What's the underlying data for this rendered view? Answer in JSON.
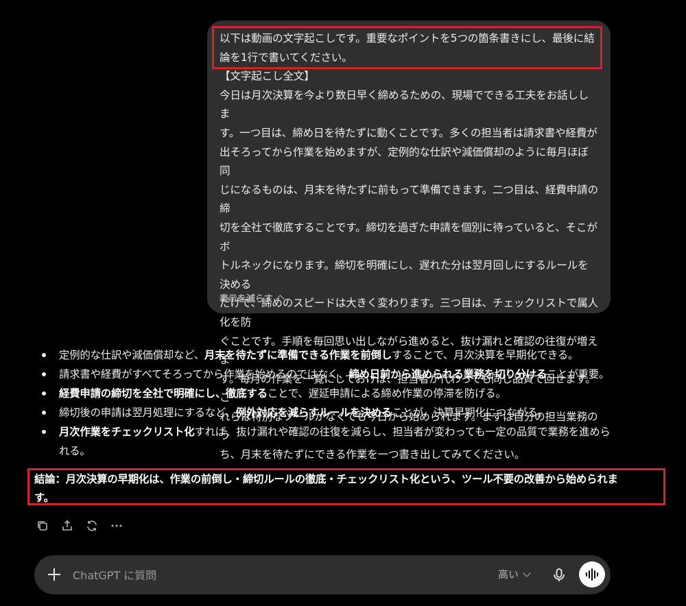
{
  "user_message": {
    "lines": [
      "以下は動画の文字起こしです。重要なポイントを5つの箇条書きにし、最後に結",
      "論を1行で書いてください。",
      "【文字起こし全文】",
      "今日は月次決算を今より数日早く締めるための、現場でできる工夫をお話ししま",
      "す。一つ目は、締め日を待たずに動くことです。多くの担当者は請求書や経費が",
      "出そろってから作業を始めますが、定例的な仕訳や減価償却のように毎月ほぼ同",
      "じになるものは、月末を待たずに前もって準備できます。二つ目は、経費申請の締",
      "切を全社で徹底することです。締切を過ぎた申請を個別に待っていると、そこがボ",
      "トルネックになります。締切を明確にし、遅れた分は翌月回しにするルールを決める",
      "だけで、締めのスピードは大きく変わります。三つ目は、チェックリストで属人化を防",
      "ぐことです。手順を毎回思い出しながら進めると、抜け漏れと確認の往復が増えま",
      "す。毎月の作業を一覧にしておけば、担当者が代わっても同じ品質で回せます。こ",
      "れらは特別なツールがなくても今日から始められます。まずは自分の担当業務のう",
      "ち、月末を待たずにできる作業を一つ書き出してみてください。"
    ],
    "show_less_label": "表示を減らす"
  },
  "response": {
    "bullets": [
      {
        "a": "定例的な仕訳や減価償却など、",
        "b": "月末を待たずに準備できる作業を前倒し",
        "c": "することで、月次決算を早期化できる。"
      },
      {
        "a": "請求書や経費がすべてそろってから作業を始めるのではなく、",
        "b": "締め日前から進められる業務を切り分ける",
        "c": "ことが重要。"
      },
      {
        "a": "",
        "b": "経費申請の締切を全社で明確にし、徹底する",
        "c": "ことで、遅延申請による締め作業の停滞を防げる。"
      },
      {
        "a": "締切後の申請は翌月処理にするなど、",
        "b": "例外対応を減らすルールを決める",
        "c": "ことが、決算早期化につながる。"
      },
      {
        "a": "",
        "b": "月次作業をチェックリスト化",
        "c": "すれば、抜け漏れや確認の往復を減らし、担当者が変わっても一定の品質で業務を進められる。"
      }
    ],
    "conclusion": "結論：月次決算の早期化は、作業の前倒し・締切ルールの徹底・チェックリスト化という、ツール不要の改善から始められます。"
  },
  "composer": {
    "placeholder": "ChatGPT に質問",
    "model_label": "高い"
  },
  "colors": {
    "background": "#000000",
    "bubble": "#2f2f2f",
    "highlight": "#d3232a"
  }
}
